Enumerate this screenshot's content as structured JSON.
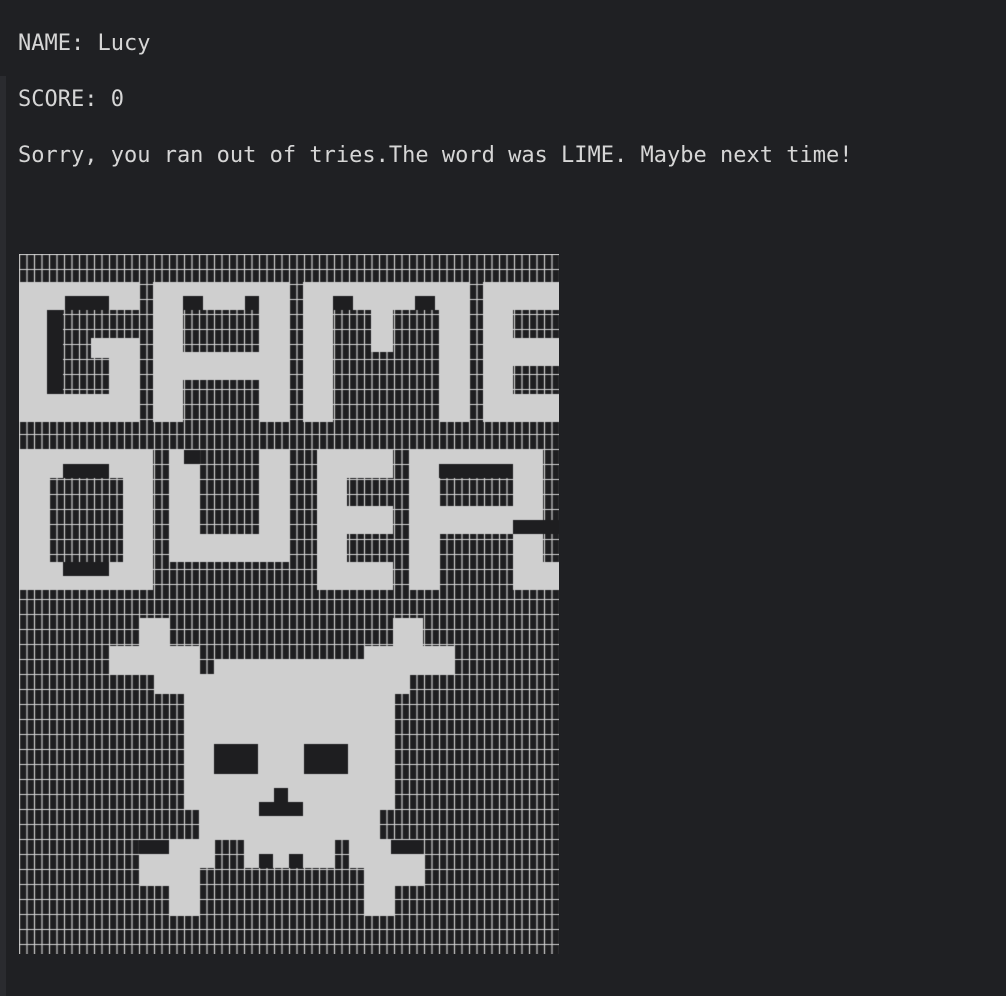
{
  "terminal": {
    "name_line": "NAME: Lucy",
    "score_line": "SCORE: 0",
    "message_line": "Sorry, you ran out of tries.The word was LIME. Maybe next time!"
  },
  "colors": {
    "background": "#1f2023",
    "text": "#d6d6d6",
    "art_fill": "#cfcfcf",
    "art_dark": "#1e1e20",
    "grid_line": "#d0d0d0"
  }
}
